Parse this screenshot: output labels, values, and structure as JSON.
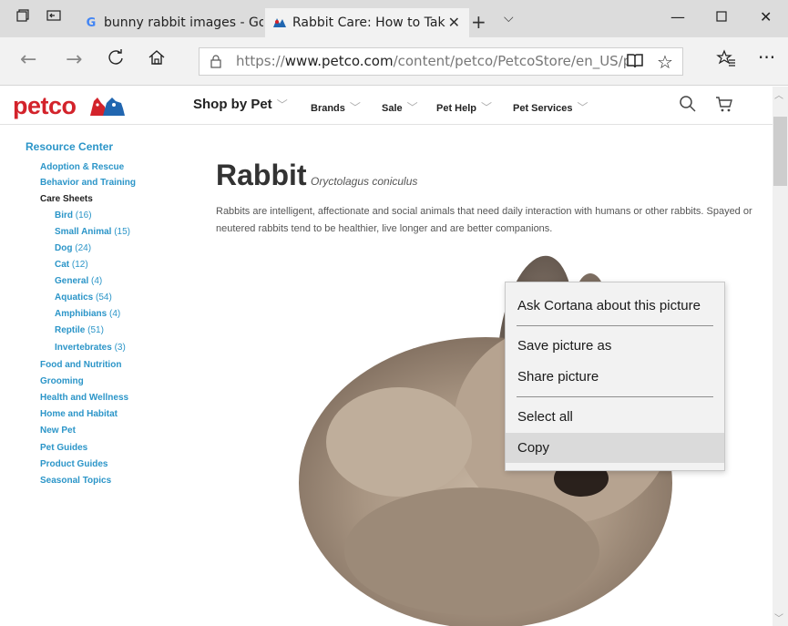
{
  "browser": {
    "tabs": [
      {
        "title": "bunny rabbit images - Goog",
        "icon": "google-icon"
      },
      {
        "title": "Rabbit Care: How to Tak",
        "icon": "petco-icon",
        "active": true
      }
    ],
    "url_prefix": "https://",
    "url_domain": "www.petco.com",
    "url_path": "/content/petco/PetcoStore/en_US/pet-servic"
  },
  "site": {
    "logo": "petco",
    "brand_color": "#d3232b",
    "nav": [
      "Shop by Pet",
      "Brands",
      "Sale",
      "Pet Help",
      "Pet Services"
    ]
  },
  "sidebar": {
    "title": "Resource Center",
    "items": [
      {
        "label": "Adoption & Rescue"
      },
      {
        "label": "Behavior and Training"
      },
      {
        "label": "Care Sheets"
      },
      {
        "label": "Bird",
        "count": "(16)"
      },
      {
        "label": "Small Animal",
        "count": "(15)"
      },
      {
        "label": "Dog",
        "count": "(24)"
      },
      {
        "label": "Cat",
        "count": "(12)"
      },
      {
        "label": "General",
        "count": "(4)"
      },
      {
        "label": "Aquatics",
        "count": "(54)"
      },
      {
        "label": "Amphibians",
        "count": "(4)"
      },
      {
        "label": "Reptile",
        "count": "(51)"
      },
      {
        "label": "Invertebrates",
        "count": "(3)"
      },
      {
        "label": "Food and Nutrition"
      },
      {
        "label": "Grooming"
      },
      {
        "label": "Health and Wellness"
      },
      {
        "label": "Home and Habitat"
      },
      {
        "label": "New Pet"
      },
      {
        "label": "Pet Guides"
      },
      {
        "label": "Product Guides"
      },
      {
        "label": "Seasonal Topics"
      }
    ]
  },
  "main": {
    "title": "Rabbit",
    "scientific_name": "Oryctolagus coniculus",
    "intro": "Rabbits are intelligent, affectionate and social animals that need daily interaction with humans or other rabbits. Spayed or neutered rabbits tend to be healthier, live longer and are better companions."
  },
  "context_menu": {
    "items": [
      "Ask Cortana about this picture",
      "Save picture as",
      "Share picture",
      "Select all",
      "Copy"
    ],
    "highlighted": "Copy"
  }
}
